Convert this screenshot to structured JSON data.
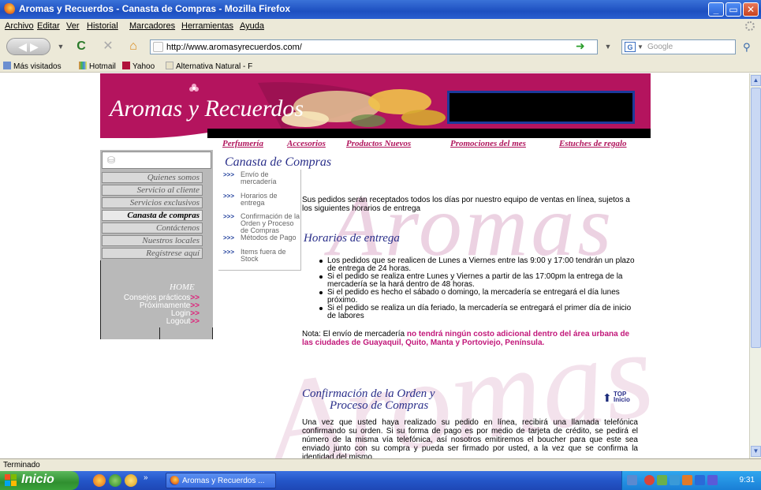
{
  "window": {
    "title": "Aromas y Recuerdos - Canasta de Compras - Mozilla Firefox",
    "controls": [
      "_",
      "▭",
      "✕"
    ]
  },
  "menubar": {
    "items": [
      "Archivo",
      "Editar",
      "Ver",
      "Historial",
      "Marcadores",
      "Herramientas",
      "Ayuda"
    ]
  },
  "toolbar": {
    "url": "http://www.aromasyrecuerdos.com/",
    "search_placeholder": "Google",
    "icons": [
      "back-icon",
      "forward-icon",
      "reload-icon",
      "stop-icon",
      "home-icon",
      "go-icon",
      "search-icon"
    ]
  },
  "bookmarks": {
    "items": [
      "Más visitados",
      "Hotmail",
      "Yahoo",
      "Alternativa Natural - F"
    ]
  },
  "site": {
    "logo": "Aromas y Recuerdos",
    "topnav": [
      "Perfumería",
      "Accesorios",
      "Productos Nuevos",
      "Promociones del mes",
      "Estuches de regalo"
    ],
    "leftnav": [
      "Quienes somos",
      "Servicio al cliente",
      "Servicios exclusivos",
      "Canasta de compras",
      "Contáctenos",
      "Nuestros locales",
      "Regístrese aquí"
    ],
    "home_label": "HOME",
    "utility_links": [
      "Consejos prácticos",
      "Próximamente",
      "Login",
      "Logout"
    ],
    "page_title": "Canasta de Compras",
    "subnav": [
      "Envío de mercadería",
      "Horarios de entrega",
      "Confirmación de la Orden y Proceso de Compras",
      "Métodos de Pago",
      "Items fuera de Stock"
    ],
    "watermark_top": "Aromas",
    "watermark_bottom": "Aromas",
    "intro": "Sus pedidos serán receptados todos los días por nuestro equipo de ventas en línea, sujetos a los siguientes horarios de entrega",
    "section1_title": "Horarios de entrega",
    "bullets": [
      "Los pedidos que se realicen de Lunes a Viernes entre las 9:00 y 17:00 tendrán un plazo de entrega de 24 horas.",
      "Si el pedido se realiza entre Lunes y Viernes a partir de las 17:00pm la entrega de la mercadería se la hará dentro de 48 horas.",
      "Si el pedido es hecho el sábado o domingo, la mercadería se entregará el día lunes próximo.",
      "Si el pedido se realiza un día feriado, la mercadería se entregará el primer día de inicio de labores"
    ],
    "note_prefix": "Nota: El envío de mercadería ",
    "note_bold": "no tendrá ningún costo adicional dentro del área urbana de las ciudades de Guayaquil, Quito, Manta y Portoviejo, Península.",
    "section2_title_1": "Confirmación de la Orden y",
    "section2_title_2": "Proceso de Compras",
    "top_label": "TOP",
    "top_sub": "Inicio",
    "section2_body": "Una vez que usted haya realizado su pedido en línea, recibirá una llamada telefónica confirmando su orden. Si su forma de pago es por medio de tarjeta de crédito, se pedirá el número de la misma vía telefónica, así nosotros emitiremos el boucher para que este sea enviado junto con su compra y pueda ser firmado por usted, a la vez que se confirma la identidad del mismo."
  },
  "statusbar": {
    "text": "Terminado"
  },
  "taskbar": {
    "start_label": "Inicio",
    "task_item": "Aromas y Recuerdos ...",
    "clock": "9:31"
  },
  "colors": {
    "title_bar": "#1d4fc0",
    "accent_magenta": "#b0145c",
    "nav_blue": "#2a2f8a",
    "sidebar_grey": "#b9b9b9"
  }
}
